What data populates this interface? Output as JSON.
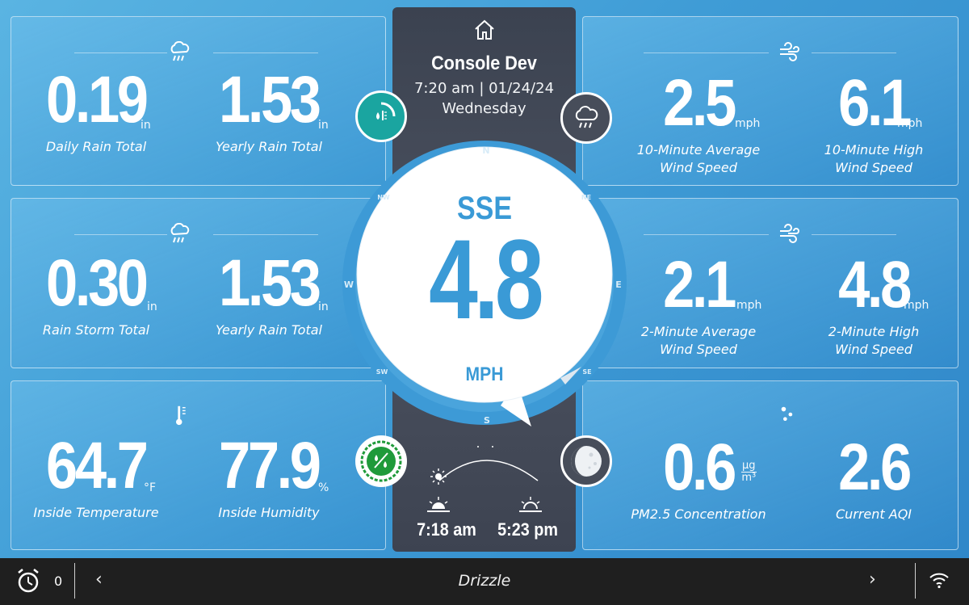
{
  "header": {
    "station_name": "Console Dev",
    "time_date": "7:20 am | 01/24/24",
    "weekday": "Wednesday",
    "home_icon": "home-icon"
  },
  "tiles": {
    "rain_daily": {
      "icon": "rain-cloud-icon",
      "left": {
        "value": "0.19",
        "unit": "in",
        "label": "Daily Rain Total"
      },
      "right": {
        "value": "1.53",
        "unit": "in",
        "label": "Yearly Rain Total"
      }
    },
    "rain_storm": {
      "icon": "rain-cloud-icon",
      "left": {
        "value": "0.30",
        "unit": "in",
        "label": "Rain Storm Total"
      },
      "right": {
        "value": "1.53",
        "unit": "in",
        "label": "Yearly Rain Total"
      }
    },
    "inside": {
      "icon": "thermometer-icon",
      "left": {
        "value": "64.7",
        "unit": "°F",
        "label": "Inside Temperature"
      },
      "right": {
        "value": "77.9",
        "unit": "%",
        "label": "Inside Humidity"
      }
    },
    "wind_10": {
      "icon": "wind-icon",
      "left": {
        "value": "2.5",
        "unit": "mph",
        "label1": "10-Minute Average",
        "label2": "Wind Speed"
      },
      "right": {
        "value": "6.1",
        "unit": "mph",
        "label1": "10-Minute High",
        "label2": "Wind Speed"
      }
    },
    "wind_2": {
      "icon": "wind-icon",
      "left": {
        "value": "2.1",
        "unit": "mph",
        "label1": "2-Minute Average",
        "label2": "Wind Speed"
      },
      "right": {
        "value": "4.8",
        "unit": "mph",
        "label1": "2-Minute High",
        "label2": "Wind Speed"
      }
    },
    "air": {
      "icon": "particles-icon",
      "left": {
        "value": "0.6",
        "unit_top": "µg",
        "unit_bottom": "m³",
        "label": "PM2.5 Concentration"
      },
      "right": {
        "value": "2.6",
        "label": "Current AQI"
      }
    }
  },
  "compass": {
    "direction": "SSE",
    "speed": "4.8",
    "unit": "MPH",
    "points": {
      "n": "N",
      "ne": "NE",
      "e": "E",
      "se": "SE",
      "s": "S",
      "sw": "SW",
      "w": "W",
      "nw": "NW"
    }
  },
  "badges": {
    "rain_rate": "rain-gauge-icon",
    "forecast": "rain-cloud-icon",
    "humidity": "humidity-drop-icon",
    "moon": "moon-phase-icon"
  },
  "sun": {
    "sunrise": "7:18 am",
    "sunset": "5:23 pm"
  },
  "bottom_bar": {
    "alarm_count": "0",
    "condition": "Drizzle"
  },
  "colors": {
    "accent_blue": "#3a9ad6",
    "teal_badge": "#1aa5a0",
    "green_badge": "#1f9a3a",
    "dark_panel": "#434957"
  }
}
